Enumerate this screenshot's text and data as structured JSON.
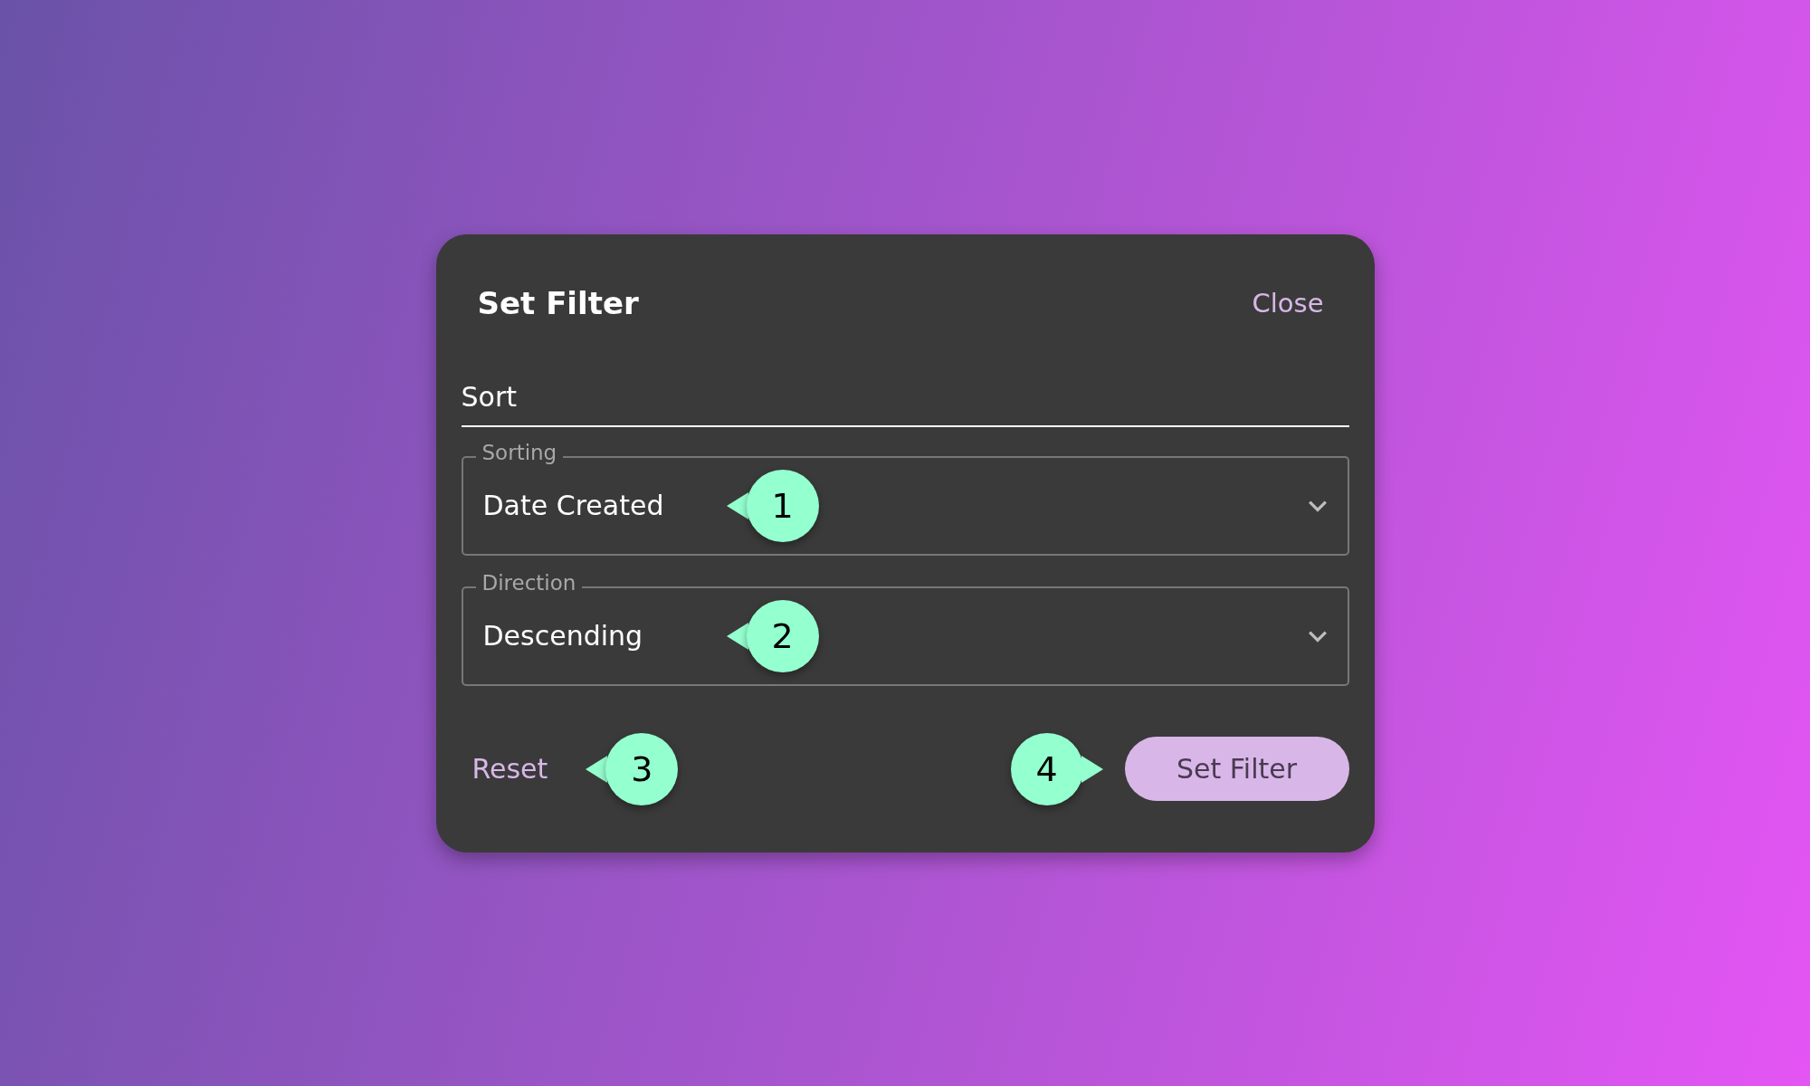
{
  "dialog": {
    "title": "Set Filter",
    "close": "Close"
  },
  "section": {
    "title": "Sort"
  },
  "fields": [
    {
      "label": "Sorting",
      "value": "Date Created",
      "callout": {
        "number": "1"
      }
    },
    {
      "label": "Direction",
      "value": "Descending",
      "callout": {
        "number": "2"
      }
    }
  ],
  "reset": {
    "label": "Reset",
    "callout": {
      "number": "3"
    }
  },
  "submit": {
    "label": "Set Filter",
    "callout": {
      "number": "4"
    }
  }
}
